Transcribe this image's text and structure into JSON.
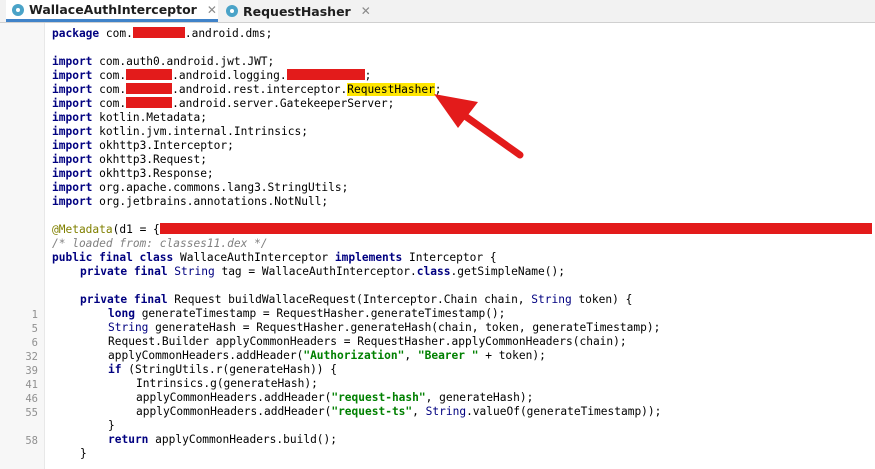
{
  "tabs": [
    {
      "label": "WallaceAuthInterceptor",
      "icon": "kotlin-class-icon",
      "active": true
    },
    {
      "label": "RequestHasher",
      "icon": "kotlin-class-icon",
      "active": false
    }
  ],
  "gutter_line_numbers": [
    "1",
    "5",
    "6",
    "32",
    "39",
    "41",
    "46",
    "55",
    "58"
  ],
  "code": {
    "package": {
      "kw": "package",
      "pre": " com.",
      "post": ".android.dms;"
    },
    "imports": [
      {
        "kw": "import",
        "text": " com.auth0.android.jwt.JWT;"
      },
      {
        "kw": "import",
        "pre": " com.",
        "mid": ".android.logging.",
        "post": ";"
      },
      {
        "kw": "import",
        "pre": " com.",
        "mid": ".android.rest.interceptor.",
        "highlight": "RequestHasher",
        "post": ";"
      },
      {
        "kw": "import",
        "pre": " com.",
        "mid": ".android.server.GatekeeperServer;",
        "post": ""
      },
      {
        "kw": "import",
        "text": " kotlin.Metadata;"
      },
      {
        "kw": "import",
        "text": " kotlin.jvm.internal.Intrinsics;"
      },
      {
        "kw": "import",
        "text": " okhttp3.Interceptor;"
      },
      {
        "kw": "import",
        "text": " okhttp3.Request;"
      },
      {
        "kw": "import",
        "text": " okhttp3.Response;"
      },
      {
        "kw": "import",
        "text": " org.apache.commons.lang3.StringUtils;"
      },
      {
        "kw": "import",
        "text": " org.jetbrains.annotations.NotNull;"
      }
    ],
    "metadata_annotation": "@Metadata",
    "metadata_rest": "(d1 = {",
    "comment": "/* loaded from: classes11.dex */",
    "class_decl": {
      "kw": "public final class",
      "name": " WallaceAuthInterceptor ",
      "kw2": "implements",
      "rest": " Interceptor {"
    },
    "field": {
      "kw": "private final",
      "type": " String",
      "rest": " tag = WallaceAuthInterceptor.",
      "kw2": "class",
      "rest2": ".getSimpleName();"
    },
    "method": {
      "kw": "private final",
      "rest": " Request buildWallaceRequest(Interceptor.Chain chain, ",
      "type": "String",
      "rest2": " token) {"
    },
    "body": [
      {
        "kw": "long",
        "text": " generateTimestamp = RequestHasher.generateTimestamp();"
      },
      {
        "type": "String",
        "text": " generateHash = RequestHasher.generateHash(chain, token, generateTimestamp);"
      },
      {
        "text": "Request.Builder applyCommonHeaders = RequestHasher.applyCommonHeaders(chain);"
      },
      {
        "text": "applyCommonHeaders.addHeader(",
        "str": "\"Authorization\"",
        "mid": ", ",
        "str2": "\"Bearer \"",
        "post": " + token);"
      },
      {
        "kw": "if",
        "text": " (StringUtils.r(generateHash)) {"
      },
      {
        "text": "Intrinsics.g(generateHash);"
      },
      {
        "text": "applyCommonHeaders.addHeader(",
        "str": "\"request-hash\"",
        "post": ", generateHash);"
      },
      {
        "text": "applyCommonHeaders.addHeader(",
        "str": "\"request-ts\"",
        "mid": ", ",
        "type": "String",
        "post": ".valueOf(generateTimestamp));"
      },
      {
        "text": "}"
      },
      {
        "kw": "return",
        "text": " applyCommonHeaders.build();"
      },
      {
        "text": "}"
      }
    ]
  },
  "colors": {
    "redaction": "#e31b1b",
    "highlight": "#ffe600",
    "arrow": "#e31b1b",
    "keyword": "#000080",
    "string": "#008000"
  }
}
